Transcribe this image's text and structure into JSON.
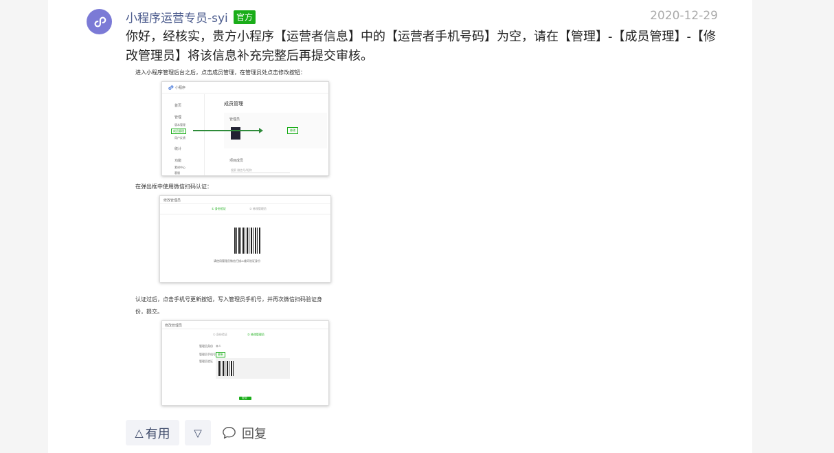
{
  "post": {
    "author": "小程序运营专员-syi",
    "badge": "官方",
    "date": "2020-12-29",
    "content": "你好，经核实，贵方小程序【运营者信息】中的【运营者手机号码】为空，请在【管理】-【成员管理】-【修改管理员】将该信息补充完整后再提交审核。"
  },
  "guide": {
    "step1": "进入小程序管理后台之后，点击成员管理，在管理员处点击修改按钮：",
    "step2": "在弹出框中使用微信扫码认证：",
    "step3_line1": "认证过后，点击手机号更新按钮，写入管理员手机号，并再次微信扫码验证身",
    "step3_line2": "份，提交。"
  },
  "shot1": {
    "app_name": "小程序",
    "page_title": "成员管理",
    "nav": [
      "首页",
      "管理",
      "版本管理",
      "成员管理",
      "用户反馈",
      "统计",
      "功能",
      "素材中心",
      "客服"
    ],
    "admin_label": "管理员",
    "edit_button": "修改",
    "member_label": "项目成员",
    "search_placeholder": "搜索 微信号/昵称"
  },
  "shot2": {
    "title": "修改管理员",
    "step_a": "① 身份验证",
    "step_b": "② 修改管理员",
    "hint": "请使用管理员微信扫描二维码验证身份"
  },
  "shot3": {
    "title": "修改管理员",
    "step_a": "① 身份验证",
    "step_b": "② 修改管理员",
    "row1_label": "管理员身份",
    "row1_value": "本人",
    "row2_label": "管理员手机号",
    "row2_button": "更新",
    "row3_label": "管理员验证",
    "submit": "提交"
  },
  "actions": {
    "useful_icon": "△",
    "useful_label": "有用",
    "down_icon": "▽",
    "reply_label": "回复"
  },
  "colors": {
    "avatar": "#7b7ad6",
    "badge": "#1aad19",
    "author": "#4a5a8c",
    "accent_green": "#1aad19"
  }
}
